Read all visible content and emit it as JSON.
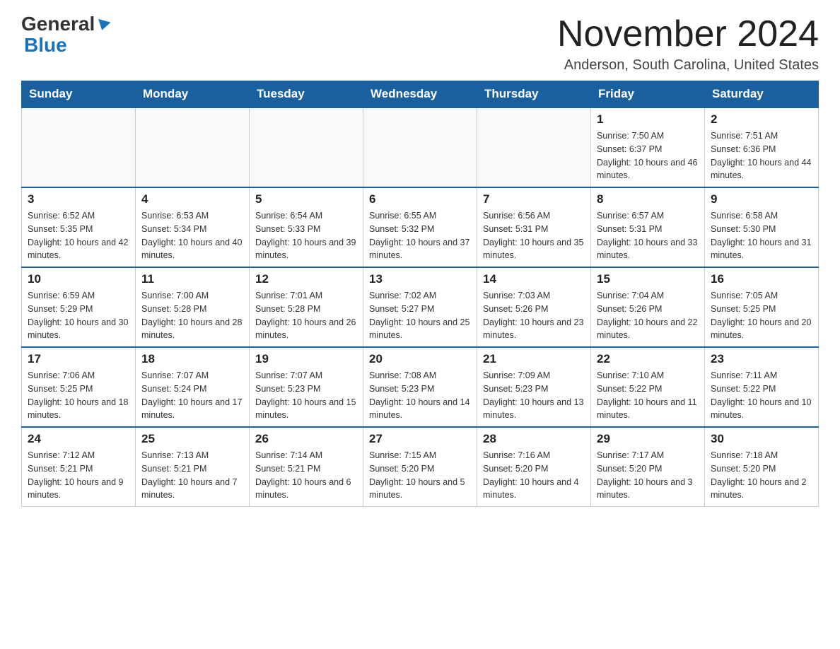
{
  "header": {
    "logo_general": "General",
    "logo_blue": "Blue",
    "month_title": "November 2024",
    "location": "Anderson, South Carolina, United States"
  },
  "weekdays": [
    "Sunday",
    "Monday",
    "Tuesday",
    "Wednesday",
    "Thursday",
    "Friday",
    "Saturday"
  ],
  "weeks": [
    [
      {
        "day": "",
        "info": ""
      },
      {
        "day": "",
        "info": ""
      },
      {
        "day": "",
        "info": ""
      },
      {
        "day": "",
        "info": ""
      },
      {
        "day": "",
        "info": ""
      },
      {
        "day": "1",
        "info": "Sunrise: 7:50 AM\nSunset: 6:37 PM\nDaylight: 10 hours and 46 minutes."
      },
      {
        "day": "2",
        "info": "Sunrise: 7:51 AM\nSunset: 6:36 PM\nDaylight: 10 hours and 44 minutes."
      }
    ],
    [
      {
        "day": "3",
        "info": "Sunrise: 6:52 AM\nSunset: 5:35 PM\nDaylight: 10 hours and 42 minutes."
      },
      {
        "day": "4",
        "info": "Sunrise: 6:53 AM\nSunset: 5:34 PM\nDaylight: 10 hours and 40 minutes."
      },
      {
        "day": "5",
        "info": "Sunrise: 6:54 AM\nSunset: 5:33 PM\nDaylight: 10 hours and 39 minutes."
      },
      {
        "day": "6",
        "info": "Sunrise: 6:55 AM\nSunset: 5:32 PM\nDaylight: 10 hours and 37 minutes."
      },
      {
        "day": "7",
        "info": "Sunrise: 6:56 AM\nSunset: 5:31 PM\nDaylight: 10 hours and 35 minutes."
      },
      {
        "day": "8",
        "info": "Sunrise: 6:57 AM\nSunset: 5:31 PM\nDaylight: 10 hours and 33 minutes."
      },
      {
        "day": "9",
        "info": "Sunrise: 6:58 AM\nSunset: 5:30 PM\nDaylight: 10 hours and 31 minutes."
      }
    ],
    [
      {
        "day": "10",
        "info": "Sunrise: 6:59 AM\nSunset: 5:29 PM\nDaylight: 10 hours and 30 minutes."
      },
      {
        "day": "11",
        "info": "Sunrise: 7:00 AM\nSunset: 5:28 PM\nDaylight: 10 hours and 28 minutes."
      },
      {
        "day": "12",
        "info": "Sunrise: 7:01 AM\nSunset: 5:28 PM\nDaylight: 10 hours and 26 minutes."
      },
      {
        "day": "13",
        "info": "Sunrise: 7:02 AM\nSunset: 5:27 PM\nDaylight: 10 hours and 25 minutes."
      },
      {
        "day": "14",
        "info": "Sunrise: 7:03 AM\nSunset: 5:26 PM\nDaylight: 10 hours and 23 minutes."
      },
      {
        "day": "15",
        "info": "Sunrise: 7:04 AM\nSunset: 5:26 PM\nDaylight: 10 hours and 22 minutes."
      },
      {
        "day": "16",
        "info": "Sunrise: 7:05 AM\nSunset: 5:25 PM\nDaylight: 10 hours and 20 minutes."
      }
    ],
    [
      {
        "day": "17",
        "info": "Sunrise: 7:06 AM\nSunset: 5:25 PM\nDaylight: 10 hours and 18 minutes."
      },
      {
        "day": "18",
        "info": "Sunrise: 7:07 AM\nSunset: 5:24 PM\nDaylight: 10 hours and 17 minutes."
      },
      {
        "day": "19",
        "info": "Sunrise: 7:07 AM\nSunset: 5:23 PM\nDaylight: 10 hours and 15 minutes."
      },
      {
        "day": "20",
        "info": "Sunrise: 7:08 AM\nSunset: 5:23 PM\nDaylight: 10 hours and 14 minutes."
      },
      {
        "day": "21",
        "info": "Sunrise: 7:09 AM\nSunset: 5:23 PM\nDaylight: 10 hours and 13 minutes."
      },
      {
        "day": "22",
        "info": "Sunrise: 7:10 AM\nSunset: 5:22 PM\nDaylight: 10 hours and 11 minutes."
      },
      {
        "day": "23",
        "info": "Sunrise: 7:11 AM\nSunset: 5:22 PM\nDaylight: 10 hours and 10 minutes."
      }
    ],
    [
      {
        "day": "24",
        "info": "Sunrise: 7:12 AM\nSunset: 5:21 PM\nDaylight: 10 hours and 9 minutes."
      },
      {
        "day": "25",
        "info": "Sunrise: 7:13 AM\nSunset: 5:21 PM\nDaylight: 10 hours and 7 minutes."
      },
      {
        "day": "26",
        "info": "Sunrise: 7:14 AM\nSunset: 5:21 PM\nDaylight: 10 hours and 6 minutes."
      },
      {
        "day": "27",
        "info": "Sunrise: 7:15 AM\nSunset: 5:20 PM\nDaylight: 10 hours and 5 minutes."
      },
      {
        "day": "28",
        "info": "Sunrise: 7:16 AM\nSunset: 5:20 PM\nDaylight: 10 hours and 4 minutes."
      },
      {
        "day": "29",
        "info": "Sunrise: 7:17 AM\nSunset: 5:20 PM\nDaylight: 10 hours and 3 minutes."
      },
      {
        "day": "30",
        "info": "Sunrise: 7:18 AM\nSunset: 5:20 PM\nDaylight: 10 hours and 2 minutes."
      }
    ]
  ]
}
